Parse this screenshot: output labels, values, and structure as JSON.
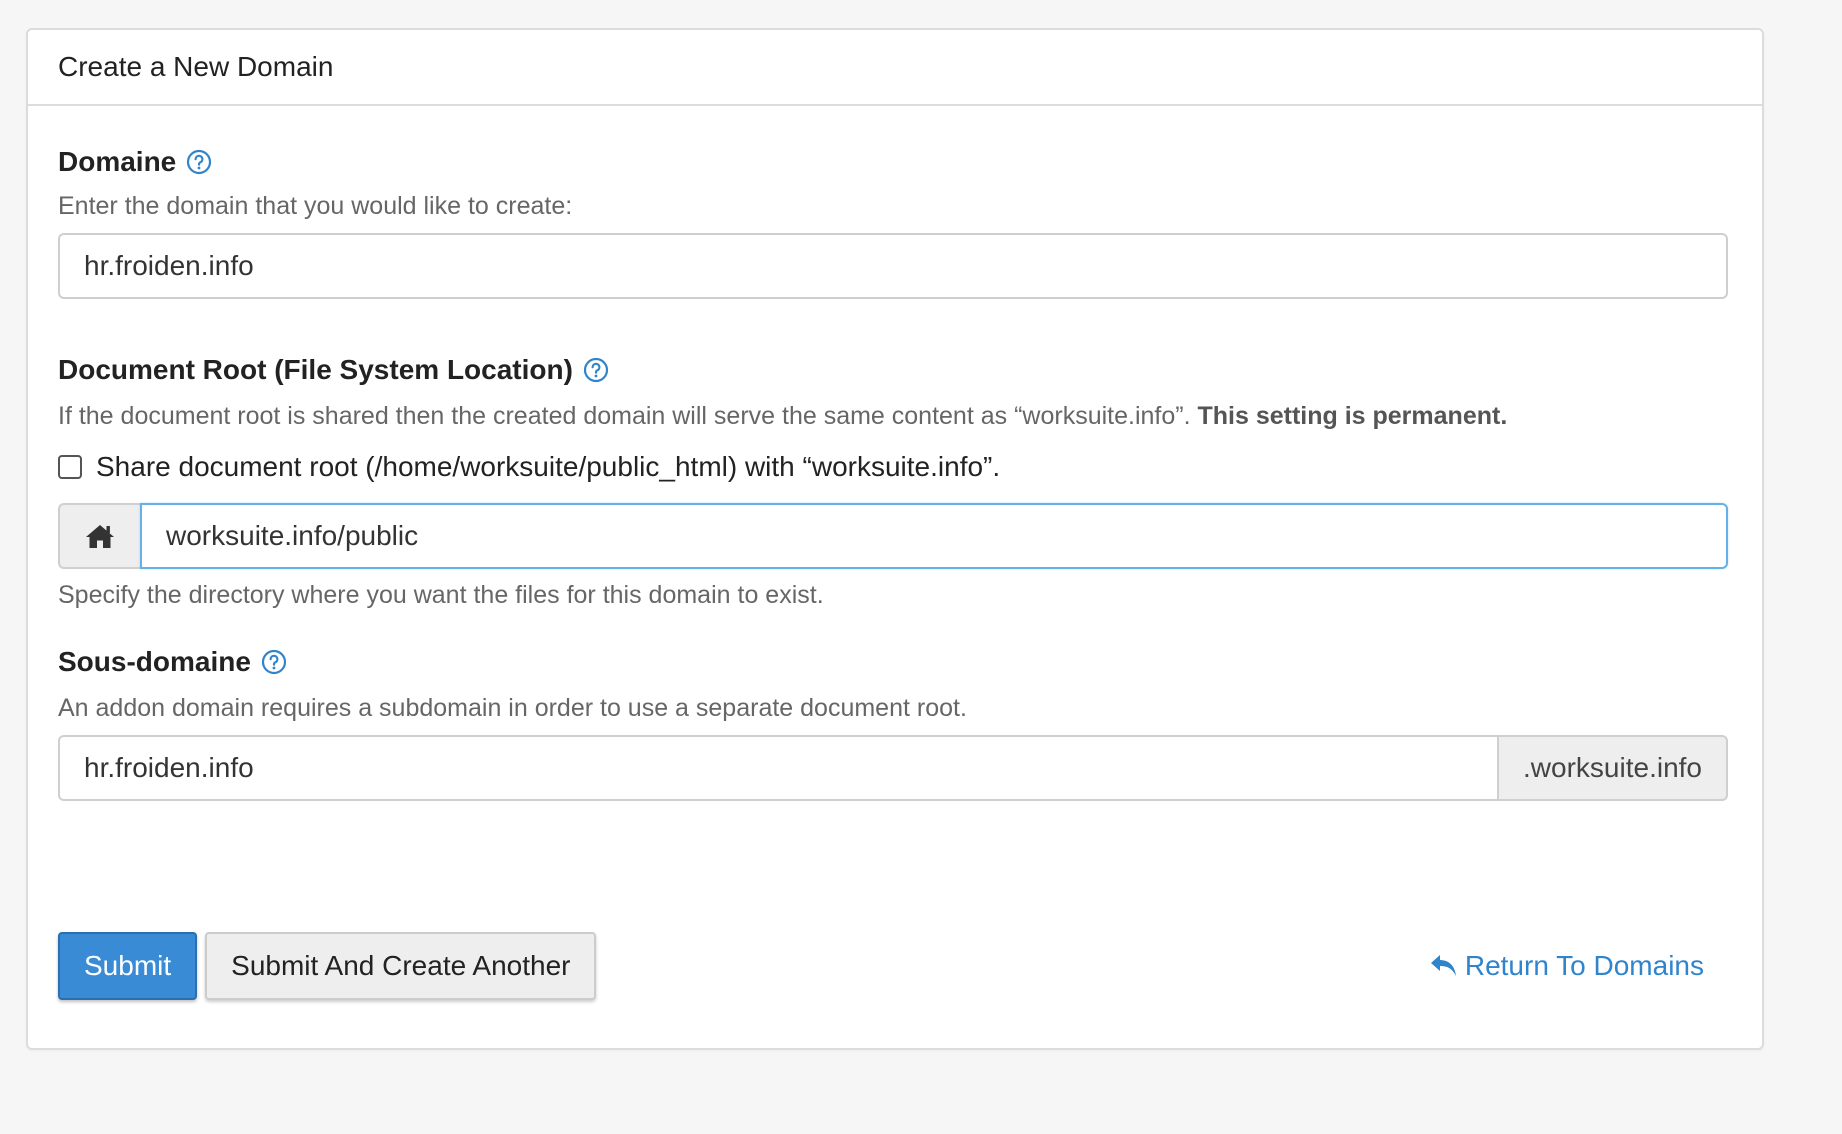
{
  "panel": {
    "title": "Create a New Domain"
  },
  "domain": {
    "label": "Domaine",
    "help": "Enter the domain that you would like to create:",
    "value": "hr.froiden.info"
  },
  "document_root": {
    "label": "Document Root (File System Location)",
    "help_prefix": "If the document root is shared then the created domain will serve the same content as “worksuite.info”.",
    "help_bold": "This setting is permanent.",
    "share_checkbox_label": "Share document root (/home/worksuite/public_html) with “worksuite.info”.",
    "share_checked": false,
    "value": "worksuite.info/public",
    "below_help": "Specify the directory where you want the files for this domain to exist."
  },
  "subdomain": {
    "label": "Sous-domaine",
    "help": "An addon domain requires a subdomain in order to use a separate document root.",
    "value": "hr.froiden.info",
    "suffix": ".worksuite.info"
  },
  "actions": {
    "submit_label": "Submit",
    "submit_another_label": "Submit And Create Another",
    "return_label": "Return To Domains"
  },
  "colors": {
    "accent": "#3a8bd6",
    "link": "#2f84cc",
    "focus_border": "#66b0e8"
  },
  "icons": {
    "help": "question-circle-icon",
    "home": "home-icon",
    "return": "reply-arrow-icon"
  }
}
